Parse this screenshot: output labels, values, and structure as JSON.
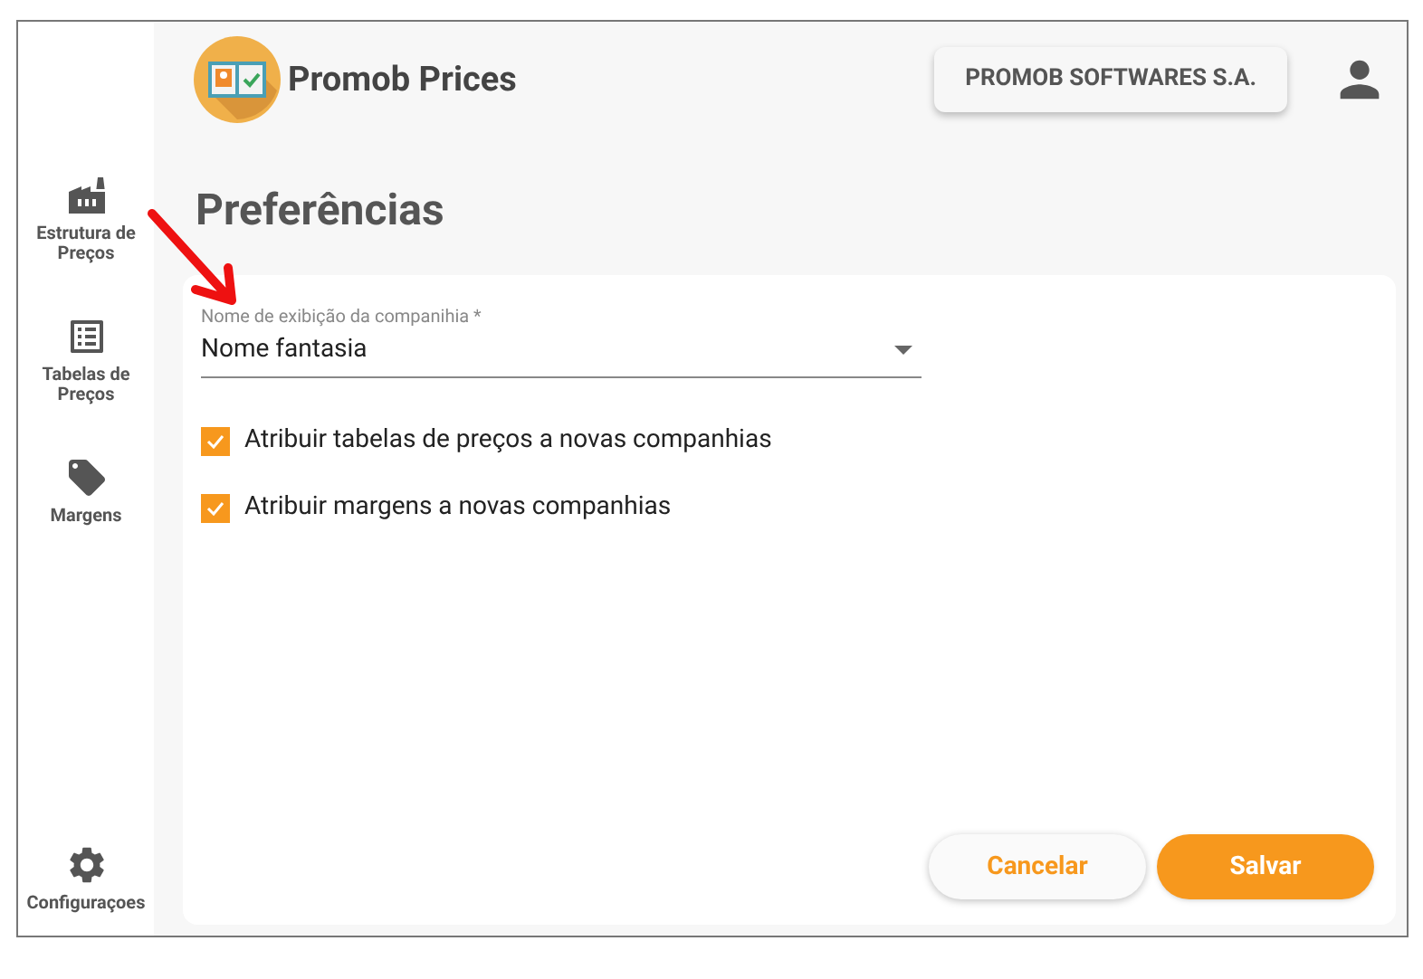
{
  "app": {
    "title": "Promob Prices"
  },
  "company_button": "PROMOB SOFTWARES S.A.",
  "sidebar": {
    "items": [
      {
        "kind": "factory",
        "label": "Estrutura de Preços"
      },
      {
        "kind": "list",
        "label": "Tabelas de Preços"
      },
      {
        "kind": "tag",
        "label": "Margens"
      }
    ],
    "footer": {
      "kind": "gear",
      "label": "Configuraçoes"
    }
  },
  "page": {
    "title": "Preferências"
  },
  "display_name_field": {
    "label": "Nome de exibição da companihia *",
    "value": "Nome fantasia"
  },
  "options": [
    {
      "label": "Atribuir tabelas de preços a novas companhias",
      "checked": true
    },
    {
      "label": "Atribuir margens a novas companhias",
      "checked": true
    }
  ],
  "buttons": [
    {
      "kind": "secondary",
      "label": "Cancelar"
    },
    {
      "kind": "primary",
      "label": "Salvar"
    }
  ]
}
